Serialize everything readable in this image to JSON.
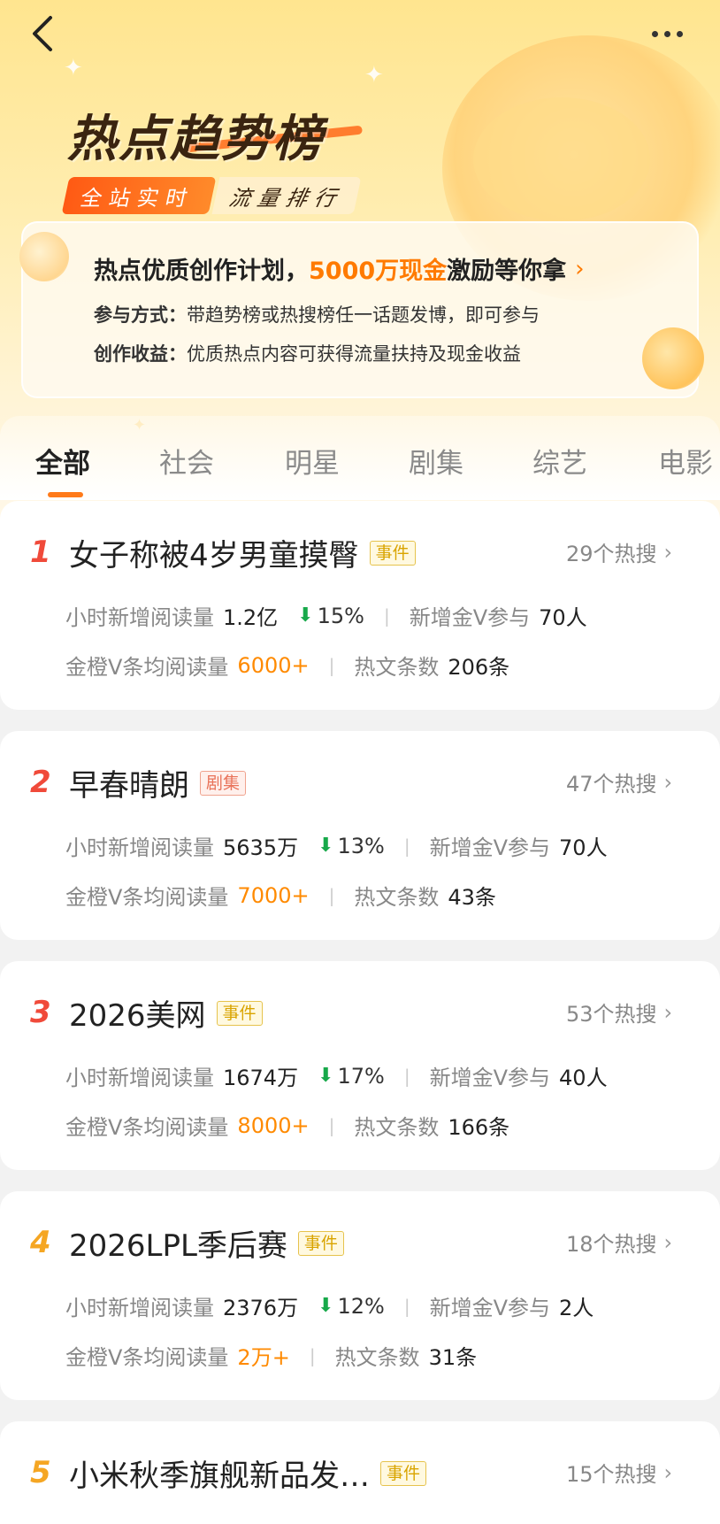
{
  "header": {
    "logo_title": "热点趋势榜",
    "tag_left": "全站实时",
    "tag_right": "流量排行"
  },
  "promo": {
    "headline_pre": "热点优质创作计划，",
    "headline_highlight": "5000万现金",
    "headline_post": "激励等你拿",
    "line1_label": "参与方式：",
    "line1_text": "带趋势榜或热搜榜任一话题发博，即可参与",
    "line2_label": "创作收益：",
    "line2_text": "优质热点内容可获得流量扶持及现金收益"
  },
  "tabs": [
    "全部",
    "社会",
    "明星",
    "剧集",
    "综艺",
    "电影"
  ],
  "labels": {
    "hourly_reads": "小时新增阅读量",
    "new_vip": "新增金V参与",
    "avg_reads": "金橙V条均阅读量",
    "hot_posts": "热文条数"
  },
  "items": [
    {
      "rank": "1",
      "title": "女子称被4岁男童摸臀",
      "badge": "事件",
      "hot": "29个热搜",
      "reads": "1.2亿",
      "change": "15%",
      "vip": "70人",
      "avg": "6000+",
      "posts": "206条"
    },
    {
      "rank": "2",
      "title": "早春晴朗",
      "badge": "剧集",
      "hot": "47个热搜",
      "reads": "5635万",
      "change": "13%",
      "vip": "70人",
      "avg": "7000+",
      "posts": "43条"
    },
    {
      "rank": "3",
      "title": "2026美网",
      "badge": "事件",
      "hot": "53个热搜",
      "reads": "1674万",
      "change": "17%",
      "vip": "40人",
      "avg": "8000+",
      "posts": "166条"
    },
    {
      "rank": "4",
      "title": "2026LPL季后赛",
      "badge": "事件",
      "hot": "18个热搜",
      "reads": "2376万",
      "change": "12%",
      "vip": "2人",
      "avg": "2万+",
      "posts": "31条"
    },
    {
      "rank": "5",
      "title": "小米秋季旗舰新品发…",
      "badge": "事件",
      "hot": "15个热搜"
    }
  ],
  "colors": {
    "rank_top": "#f04a3a",
    "rank_other": "#f5a623",
    "accent": "#ff7a00",
    "down": "#17a94a"
  },
  "icons": {
    "back": "back-chevron-icon",
    "more": "more-dots-icon",
    "chevron": "chevron-right-icon",
    "down": "arrow-down-icon"
  }
}
